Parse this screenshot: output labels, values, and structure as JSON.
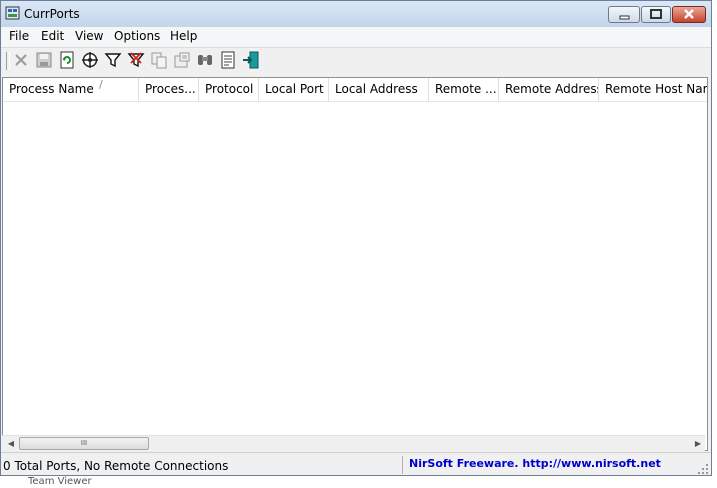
{
  "window": {
    "title": "CurrPorts",
    "minimize_icon": "minimize-icon",
    "maximize_icon": "maximize-icon",
    "close_icon": "close-icon"
  },
  "menu": [
    "File",
    "Edit",
    "View",
    "Options",
    "Help"
  ],
  "toolbar_icons": [
    "delete-icon",
    "save-icon",
    "refresh-icon",
    "properties-icon",
    "filter-icon",
    "advanced-filter-icon",
    "copy-icon",
    "html-report-icon",
    "find-icon",
    "text-report-icon",
    "exit-icon"
  ],
  "columns": [
    "Process Name",
    "Proces...",
    "Protocol",
    "Local Port",
    "Local Address",
    "Remote ...",
    "Remote Address",
    "Remote Host Name"
  ],
  "sort_indicator": "/",
  "scrollbar": {
    "left_arrow": "◀",
    "right_arrow": "▶",
    "thumb_grip": "III"
  },
  "status": {
    "summary": "0 Total Ports, No Remote Connections",
    "credit": "NirSoft Freeware.  http://www.nirsoft.net"
  },
  "background_text": "Team Viewer"
}
